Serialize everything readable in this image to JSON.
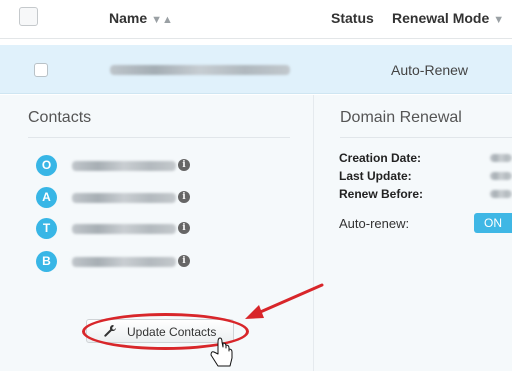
{
  "header": {
    "name_label": "Name",
    "sort_arrows": "▼▲",
    "status_label": "Status",
    "renewal_label": "Renewal Mode",
    "renewal_sort": "▼"
  },
  "domain_row": {
    "renewal_mode": "Auto-Renew"
  },
  "contacts": {
    "title": "Contacts",
    "items": [
      {
        "letter": "O"
      },
      {
        "letter": "A"
      },
      {
        "letter": "T"
      },
      {
        "letter": "B"
      }
    ],
    "info_glyph": "i",
    "update_label": "Update Contacts"
  },
  "renewal": {
    "title": "Domain Renewal",
    "creation_label": "Creation Date:",
    "update_label": "Last Update:",
    "renew_label": "Renew Before:",
    "autorenew_label": "Auto-renew:",
    "toggle_on": "ON"
  },
  "colors": {
    "accent": "#38b6e6",
    "annotation": "#d8262a",
    "selected_row": "#e0f1fb"
  }
}
